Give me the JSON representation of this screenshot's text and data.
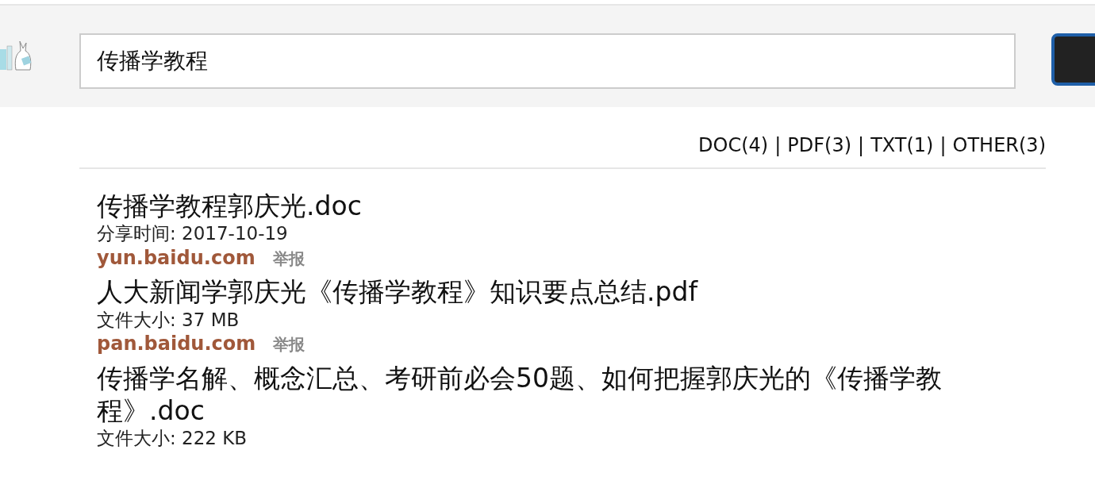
{
  "search": {
    "value": "传播学教程"
  },
  "filter_bar": [
    {
      "label": "DOC(4)",
      "separator": "|"
    },
    {
      "label": "PDF(3)",
      "separator": "|"
    },
    {
      "label": "TXT(1)",
      "separator": "|"
    },
    {
      "label": "OTHER(3)"
    }
  ],
  "results": [
    {
      "title": "传播学教程郭庆光.doc",
      "meta": "分享时间: 2017-10-19",
      "source": "yun.baidu.com",
      "report": "举报"
    },
    {
      "title": "人大新闻学郭庆光《传播学教程》知识要点总结.pdf",
      "meta": "文件大小: 37 MB",
      "source": "pan.baidu.com",
      "report": "举报"
    },
    {
      "title": "传播学名解、概念汇总、考研前必会50题、如何把握郭庆光的《传播学教程》.doc",
      "meta": "文件大小: 222 KB"
    }
  ]
}
